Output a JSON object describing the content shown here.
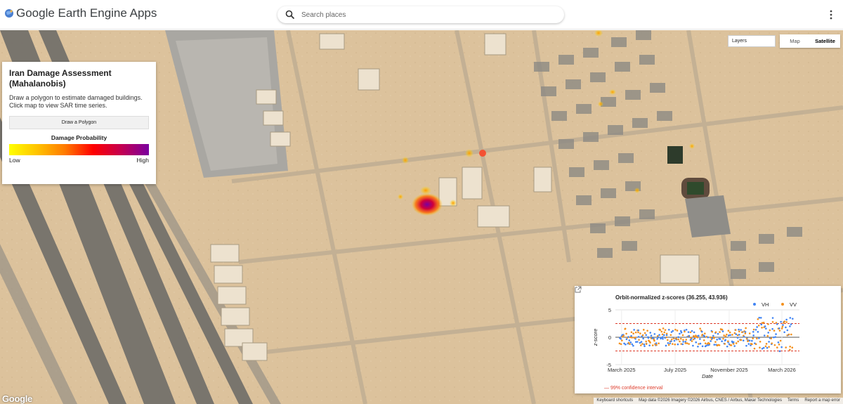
{
  "header": {
    "app_title": "Google Earth Engine Apps",
    "search_placeholder": "Search places"
  },
  "info_panel": {
    "title": "Iran Damage Assessment (Mahalanobis)",
    "description": "Draw a polygon to estimate damaged buildings. Click map to view SAR time series.",
    "draw_button_label": "Draw a Polygon",
    "legend": {
      "title": "Damage Probability",
      "low_label": "Low",
      "high_label": "High",
      "colors": [
        "#ffff00",
        "#ffc300",
        "#ff7a00",
        "#ff0000",
        "#c40050",
        "#7a00a0"
      ]
    }
  },
  "map_controls": {
    "layers_label": "Layers",
    "map_label": "Map",
    "satellite_label": "Satellite",
    "active": "Satellite"
  },
  "chart_panel": {
    "chart_data": {
      "type": "scatter",
      "title": "Orbit-normalized z-scores (36.255, 43.936)",
      "xlabel": "Date",
      "ylabel": "z-score",
      "x_ticks": [
        "March 2025",
        "July 2025",
        "November 2025",
        "March 2026"
      ],
      "y_ticks": [
        5,
        0,
        -5
      ],
      "ylim": [
        -5,
        5
      ],
      "xlim": [
        "2025-02-15",
        "2026-04-10"
      ],
      "series": [
        {
          "name": "VH",
          "color": "#4285f4"
        },
        {
          "name": "VV",
          "color": "#f4911e"
        }
      ],
      "confidence_interval": {
        "label": "— 99% confidence interval",
        "upper": 2.5,
        "lower": -2.5,
        "color": "#dd3b2a"
      }
    }
  },
  "footer": {
    "google_logo": "Google",
    "keyboard_shortcuts": "Keyboard shortcuts",
    "map_data": "Map data ©2026 Imagery ©2026 Airbus, CNES / Airbus, Maxar Technologies",
    "terms": "Terms",
    "report": "Report a map error"
  }
}
